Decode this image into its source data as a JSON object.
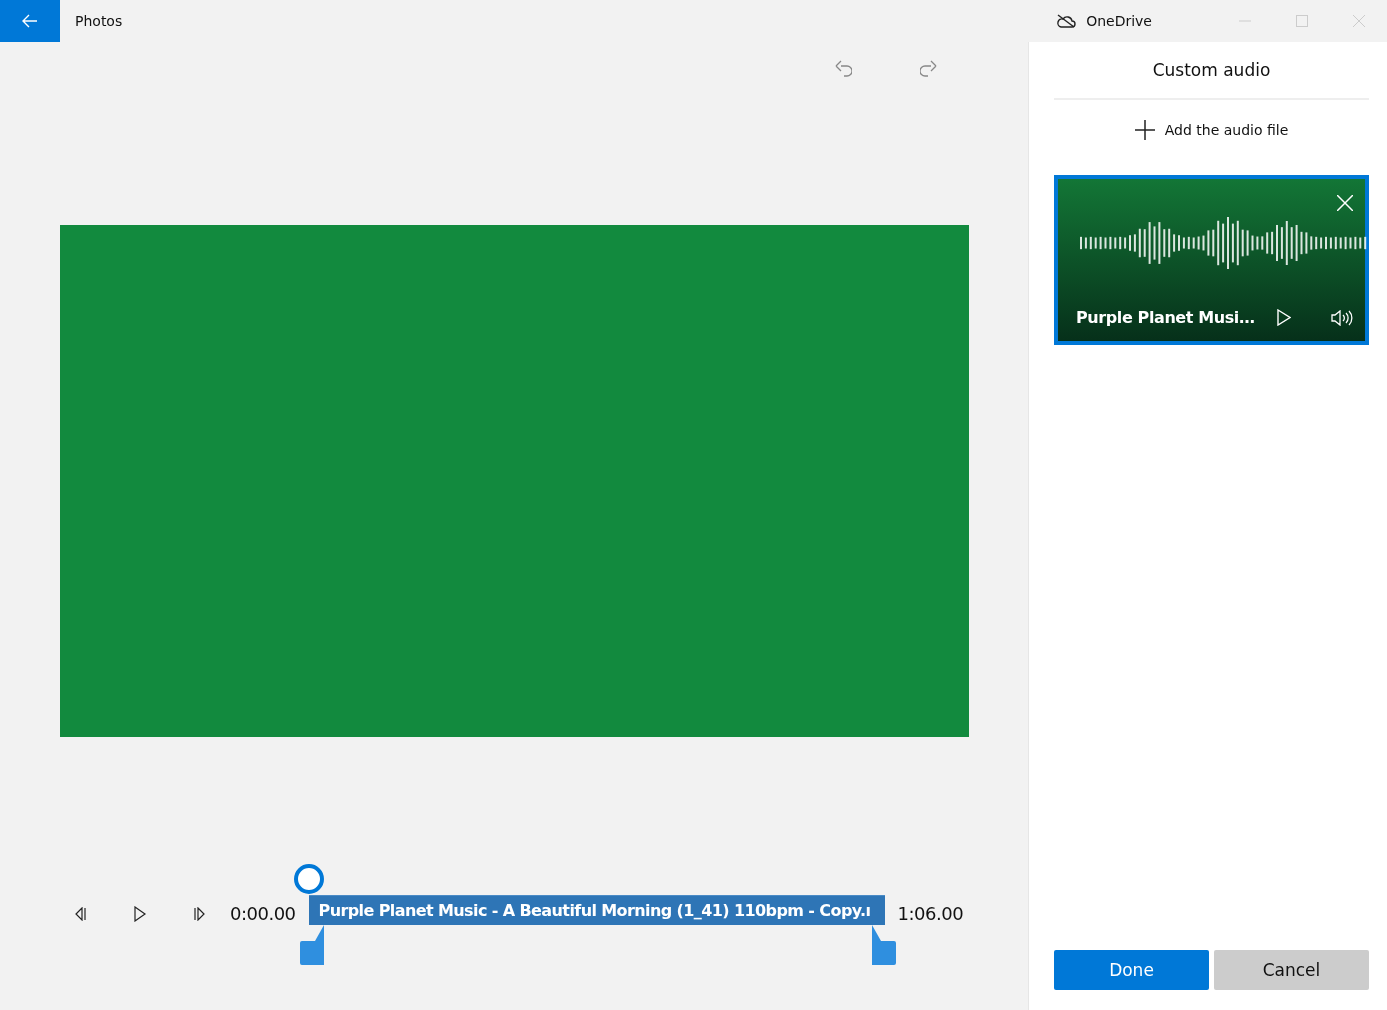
{
  "window": {
    "title": "Photos",
    "account": "OneDrive"
  },
  "panel": {
    "title": "Custom audio",
    "add_button": "Add the audio file",
    "audio_cards": [
      {
        "title": "Purple Planet Musi…",
        "selected": true
      }
    ],
    "buttons": [
      {
        "label": "Done",
        "kind": "primary"
      },
      {
        "label": "Cancel",
        "kind": "secondary"
      }
    ]
  },
  "timeline": {
    "start_time": "0:00.00",
    "end_time": "1:06.00",
    "clip_title": "Purple Planet Music - A Beautiful Morning (1_41) 110bpm - Copy.ı",
    "level": 0
  }
}
